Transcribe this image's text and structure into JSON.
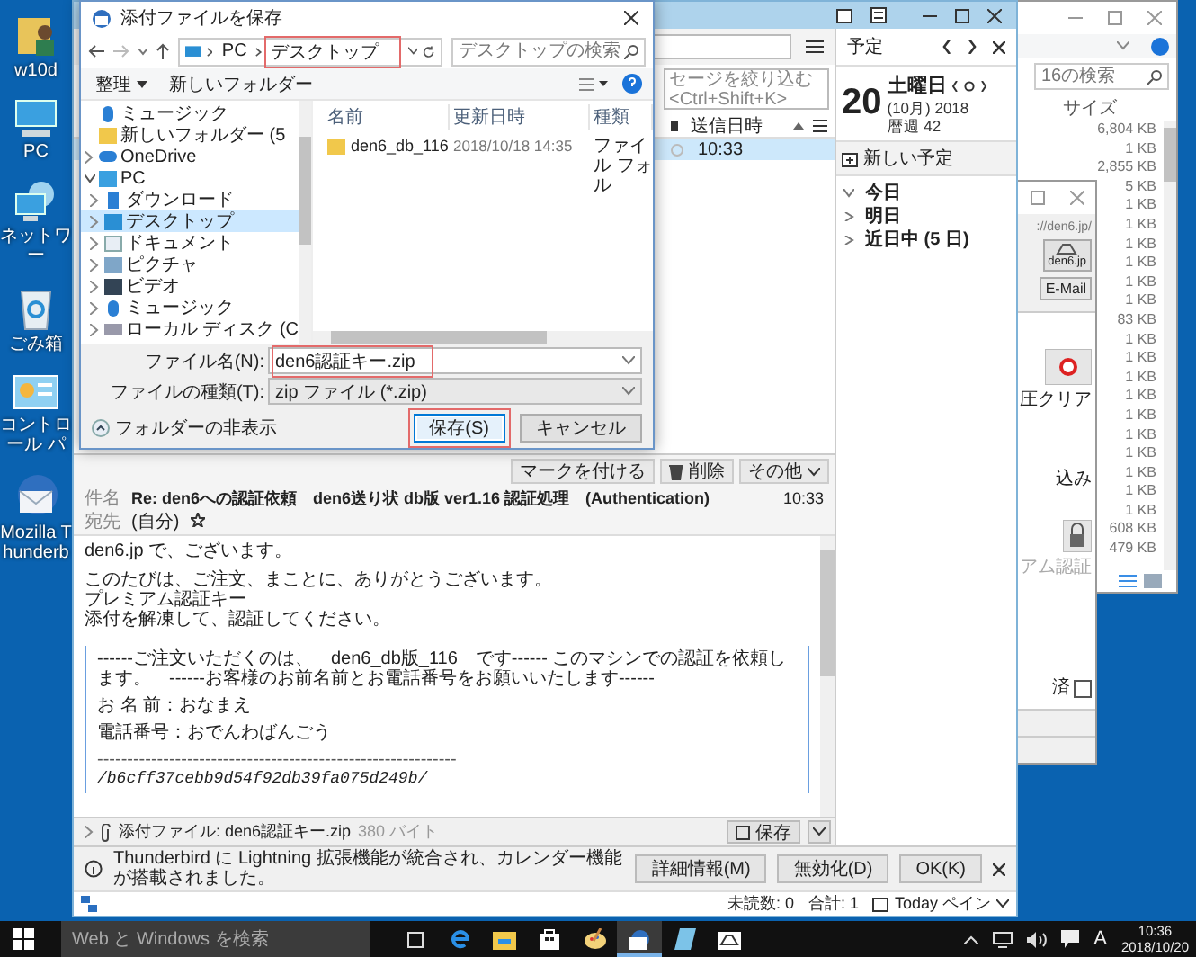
{
  "desktop": {
    "icons": [
      {
        "kind": "user-folder",
        "label": "w10d"
      },
      {
        "kind": "pc",
        "label": "PC"
      },
      {
        "kind": "network",
        "label": "ネットワー"
      },
      {
        "kind": "recycle",
        "label": "ごみ箱"
      },
      {
        "kind": "control",
        "label": "コントロール パ"
      },
      {
        "kind": "thunderbird",
        "label": "Mozilla Thunderb"
      }
    ]
  },
  "explorer_window": {
    "search": {
      "placeholder": "16の検索"
    },
    "size_column": "サイズ",
    "sizes": [
      "6,804 KB",
      "1 KB",
      "2,855 KB",
      "5 KB",
      "1 KB",
      "1 KB",
      "1 KB",
      "1 KB",
      "1 KB",
      "1 KB",
      "83 KB",
      "1 KB",
      "1 KB",
      "1 KB",
      "1 KB",
      "1 KB",
      "1 KB",
      "1 KB",
      "1 KB",
      "1 KB",
      "1 KB",
      "608 KB",
      "479 KB"
    ]
  },
  "den6_window": {
    "url": "://den6.jp/",
    "site_button": "den6.jp",
    "email_button": "E-Mail",
    "clear_label": "圧クリア",
    "label_2": "込み",
    "auth_label": "アム認証",
    "paid": {
      "label": "済",
      "checked": false
    }
  },
  "thunderbird": {
    "filter": {
      "placeholder": "セージを絞り込む <Ctrl+Shift+K>"
    },
    "list_column": "送信日時",
    "messages": [
      {
        "time": "10:33",
        "selected": true
      }
    ],
    "message_buttons": [
      {
        "kind": "mark",
        "label": "マークを付ける"
      },
      {
        "kind": "delete",
        "label": "削除"
      },
      {
        "kind": "more",
        "label": "その他"
      }
    ],
    "header": {
      "subject_label": "件名",
      "subject": "Re: den6への認証依頼　den6送り状 db版 ver1.16 認証処理　(Authentication)",
      "time": "10:33",
      "to_label": "宛先",
      "to": "(自分)"
    },
    "paragraphs": [
      [
        "den6.jp で、ございます。"
      ],
      [
        "このたびは、ご注文、まことに、ありがとうございます。",
        "プレミアム認証キー",
        "添付を解凍して、認証してください。"
      ]
    ],
    "quote": [
      {
        "kind": "text",
        "text": "------ご注文いただくのは、　den6_db版_116　です------ このマシンでの認証を依頼します。　------お客様のお前名前とお電話番号をお願いいたします------"
      },
      {
        "kind": "text",
        "text": "お 名 前：おなまえ"
      },
      {
        "kind": "text",
        "text": "電話番号：おでんわばんごう"
      },
      {
        "kind": "rule",
        "text": "------------------------------------------------------------"
      },
      {
        "kind": "code",
        "text": "/b6cff37cebb9d54f92db39fa075d249b/"
      }
    ],
    "attachment": {
      "label": "添付ファイル: den6認証キー.zip",
      "size": "380 バイト",
      "save": "保存"
    },
    "notification": {
      "text": "Thunderbird に Lightning 拡張機能が統合され、カレンダー機能が搭載されました。",
      "buttons": [
        "詳細情報(M)",
        "無効化(D)",
        "OK(K)"
      ]
    },
    "status": {
      "unread": "未読数: 0",
      "total": "合計: 1",
      "today_pane": "Today ペイン"
    }
  },
  "calendar": {
    "title": "予定",
    "day": "20",
    "weekday": "土曜日",
    "month_year": "(10月) 2018",
    "week": "暦週 42",
    "new_event": "新しい予定",
    "agenda": [
      {
        "label": "今日",
        "expanded": true
      },
      {
        "label": "明日",
        "expanded": false
      },
      {
        "label": "近日中 (5 日)",
        "expanded": false
      }
    ]
  },
  "save_dialog": {
    "title": "添付ファイルを保存",
    "path": [
      "PC",
      "デスクトップ"
    ],
    "path_highlighted": true,
    "search": {
      "placeholder": "デスクトップの検索"
    },
    "toolbar": [
      "整理",
      "新しいフォルダー"
    ],
    "nav": [
      {
        "label": "ミュージック",
        "kind": "music",
        "selected": false
      },
      {
        "label": "新しいフォルダー (5",
        "kind": "folder",
        "selected": false
      },
      {
        "label": "OneDrive",
        "kind": "cloud",
        "expanded": false,
        "selected": false
      },
      {
        "label": "PC",
        "kind": "pc",
        "expanded": true,
        "selected": false,
        "children": [
          {
            "label": "ダウンロード",
            "kind": "download",
            "expanded": false,
            "selected": false
          },
          {
            "label": "デスクトップ",
            "kind": "desktop",
            "expanded": false,
            "selected": true
          },
          {
            "label": "ドキュメント",
            "kind": "document",
            "expanded": false,
            "selected": false
          },
          {
            "label": "ピクチャ",
            "kind": "picture",
            "expanded": false,
            "selected": false
          },
          {
            "label": "ビデオ",
            "kind": "video",
            "expanded": false,
            "selected": false
          },
          {
            "label": "ミュージック",
            "kind": "music",
            "expanded": false,
            "selected": false
          },
          {
            "label": "ローカル ディスク (C",
            "kind": "disk",
            "expanded": false,
            "selected": false
          }
        ]
      }
    ],
    "columns": [
      "名前",
      "更新日時",
      "種類"
    ],
    "rows": [
      {
        "name": "den6_db_116",
        "modified": "2018/10/18 14:35",
        "type": "ファイル フォル"
      }
    ],
    "file_name": {
      "label": "ファイル名(N):",
      "value": "den6認証キー.zip",
      "highlighted": true
    },
    "file_type": {
      "label": "ファイルの種類(T):",
      "value": "zip ファイル (*.zip)"
    },
    "hide_folders": "フォルダーの非表示",
    "buttons": [
      {
        "label": "保存(S)",
        "kind": "primary",
        "highlighted": true
      },
      {
        "label": "キャンセル",
        "kind": "normal",
        "highlighted": false
      }
    ]
  },
  "taskbar": {
    "search": {
      "placeholder": "Web と Windows を検索"
    },
    "apps": [
      {
        "kind": "task-view",
        "selected": false
      },
      {
        "kind": "browser",
        "selected": false
      },
      {
        "kind": "folder",
        "selected": false
      },
      {
        "kind": "store",
        "selected": false
      },
      {
        "kind": "paint",
        "selected": false
      },
      {
        "kind": "mail",
        "selected": true
      },
      {
        "kind": "notepad",
        "selected": false
      },
      {
        "kind": "scanner",
        "selected": false
      }
    ],
    "ime": "A",
    "time": "10:36",
    "date": "2018/10/20"
  }
}
